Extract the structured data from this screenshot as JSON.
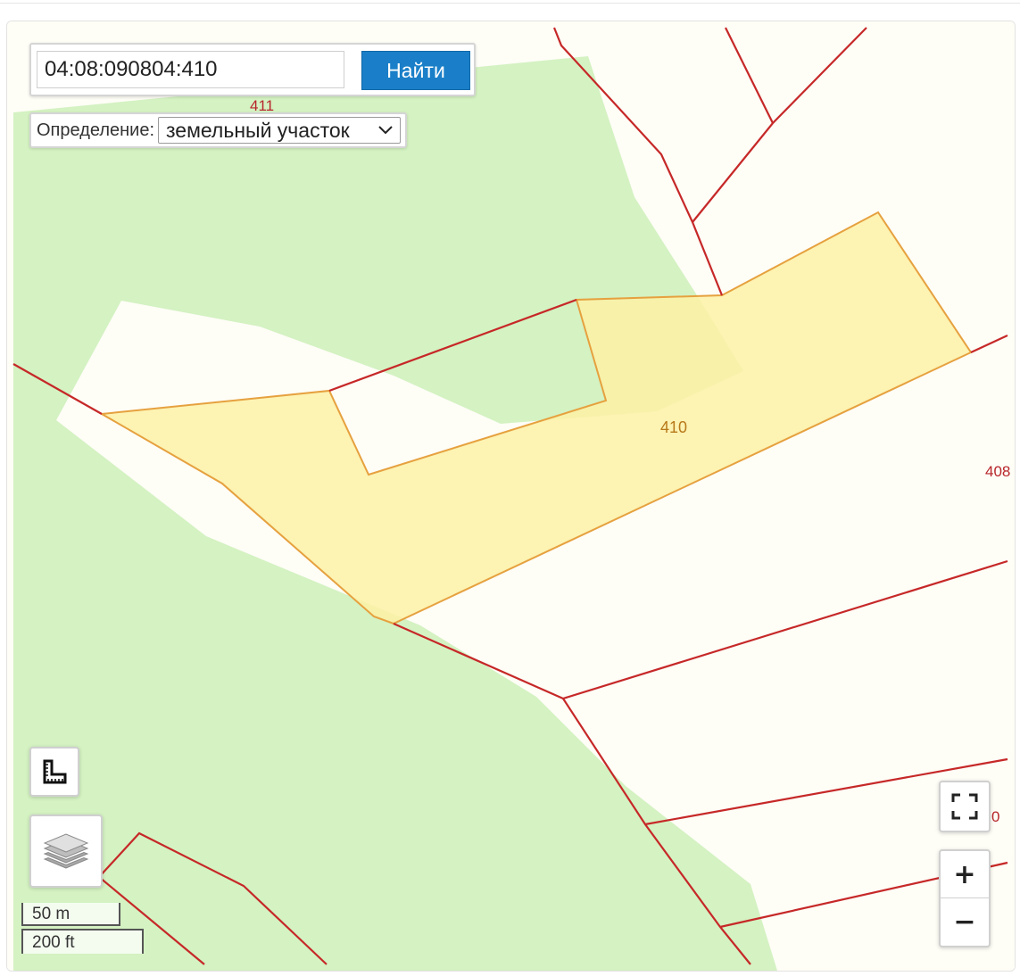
{
  "search": {
    "value": "04:08:090804:410",
    "button_label": "Найти"
  },
  "definition": {
    "label": "Определение:",
    "selected": "земельный участок"
  },
  "parcels": {
    "label_411": "411",
    "label_410": "410",
    "label_408": "408",
    "label_partial_right": "0"
  },
  "scale": {
    "metric": "50 m",
    "imperial": "200 ft"
  },
  "controls": {
    "zoom_in": "+",
    "zoom_out": "−"
  },
  "colors": {
    "forest": "#d4f2c2",
    "selected_parcel": "#fdf1a6",
    "boundary": "#c62828",
    "button": "#1a7fc8"
  },
  "icons": {
    "ruler": "ruler-icon",
    "layers": "layers-icon",
    "fullscreen": "fullscreen-icon"
  }
}
